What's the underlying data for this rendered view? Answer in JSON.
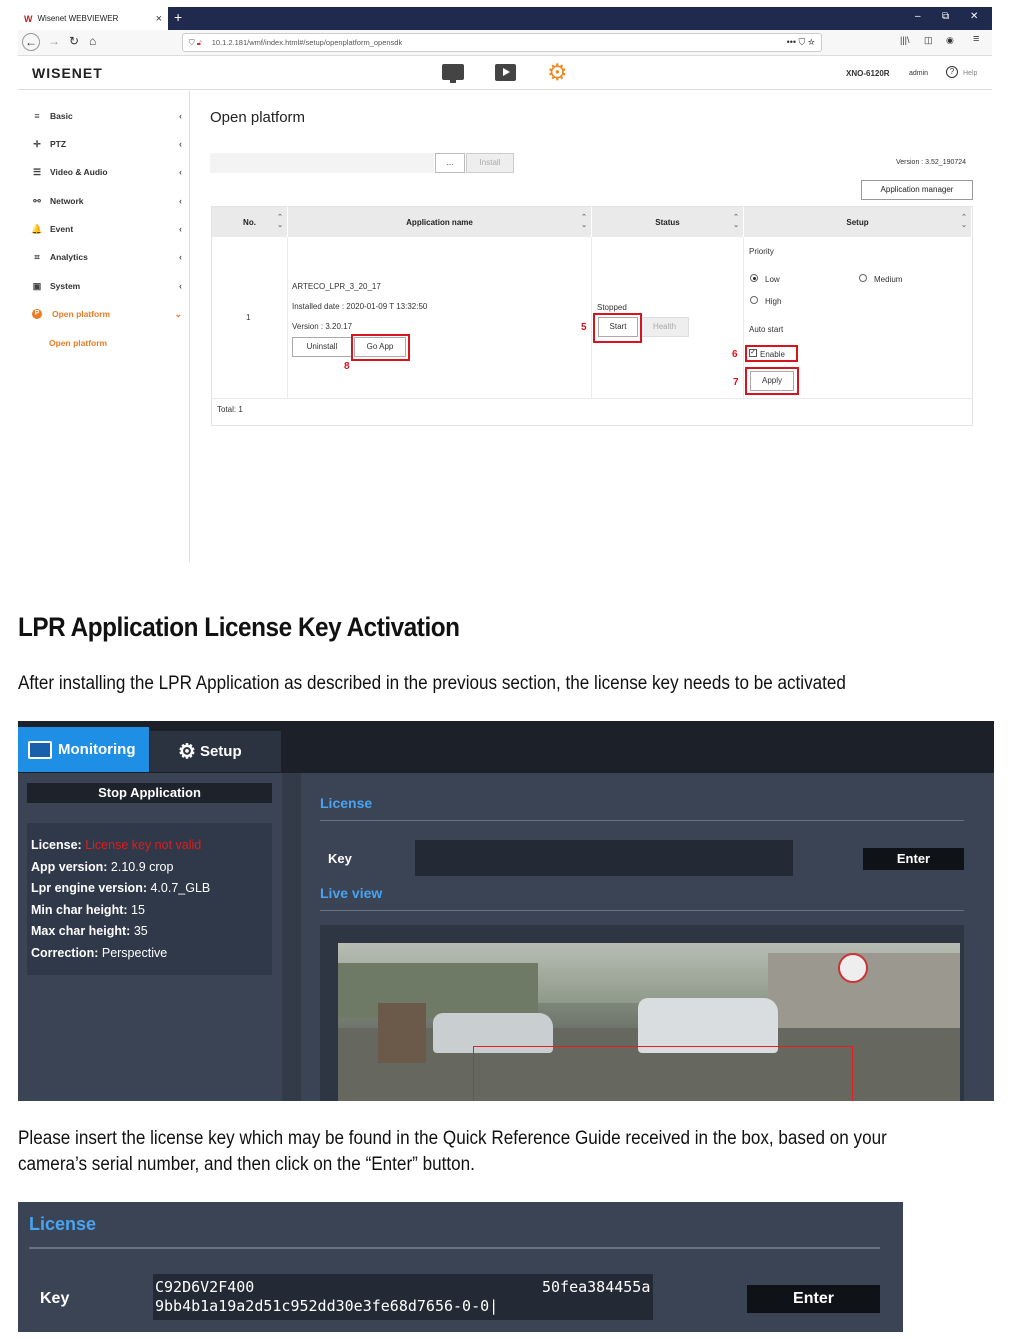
{
  "browser": {
    "tab_title": "Wisenet WEBVIEWER",
    "tab_logo": "W",
    "new_tab": "+",
    "url": "10.1.2.181/wmf/index.html#/setup/openplatform_opensdk",
    "url_dots": "•••",
    "win_min": "–",
    "win_restore": "⧉",
    "win_close": "✕"
  },
  "webviewer": {
    "logo": "WISENET",
    "model": "XNO-6120R",
    "user": "admin",
    "help": "Help",
    "help_icon": "?"
  },
  "sidebar": {
    "items": [
      {
        "label": "Basic",
        "icon": "≡"
      },
      {
        "label": "PTZ",
        "icon": "✛"
      },
      {
        "label": "Video & Audio",
        "icon": "☰"
      },
      {
        "label": "Network",
        "icon": "⚯"
      },
      {
        "label": "Event",
        "icon": "🔔"
      },
      {
        "label": "Analytics",
        "icon": "⌗"
      },
      {
        "label": "System",
        "icon": "▣"
      },
      {
        "label": "Open platform",
        "icon": "P"
      }
    ],
    "sub_item": "Open platform"
  },
  "content": {
    "title": "Open platform",
    "browse_button": "...",
    "install_button": "Install",
    "version": "Version : 3.52_190724",
    "app_manager_button": "Application manager",
    "table": {
      "headers": [
        "No.",
        "Application name",
        "Status",
        "Setup"
      ],
      "row": {
        "no": "1",
        "app_name": "ARTECO_LPR_3_20_17",
        "installed_date": "Installed date : 2020-01-09 T 13:32:50",
        "version": "Version : 3.20.17",
        "uninstall": "Uninstall",
        "go_app": "Go App",
        "status": "Stopped",
        "start": "Start",
        "health": "Health",
        "priority_label": "Priority",
        "priority_low": "Low",
        "priority_medium": "Medium",
        "priority_high": "High",
        "priority_selected": "Low",
        "auto_start_label": "Auto start",
        "enable_label": "Enable",
        "enable_checked": true,
        "apply": "Apply"
      },
      "total": "Total: 1"
    },
    "markers": [
      "5",
      "6",
      "7",
      "8"
    ]
  },
  "doc": {
    "heading": "LPR Application License Key Activation",
    "para1": "After installing the LPR Application as described in the previous section, the license key needs to be activated",
    "para2_line1": "Please insert the license key which may be found in the Quick Reference Guide received in the box, based on your",
    "para2_line2": "camera’s serial number, and then click on the “Enter” button."
  },
  "arteco": {
    "monitoring_tab": "Monitoring",
    "setup_tab": "Setup",
    "stop_button": "Stop Application",
    "info": {
      "license_label": "License:",
      "license_value": "License key not valid",
      "app_version_label": "App version:",
      "app_version_value": "2.10.9 crop",
      "lpr_engine_label": "Lpr engine version:",
      "lpr_engine_value": "4.0.7_GLB",
      "min_char_label": "Min char height:",
      "min_char_value": "15",
      "max_char_label": "Max char height:",
      "max_char_value": "35",
      "correction_label": "Correction:",
      "correction_value": "Perspective"
    },
    "license_section": "License",
    "key_label": "Key",
    "enter_button": "Enter",
    "live_view_section": "Live view"
  },
  "license_zoom": {
    "title": "License",
    "key_label": "Key",
    "key_line1_start": "C92D6V2F400",
    "key_line1_end": "50fea384455a",
    "key_line2": "9bb4b1a19a2d51c952dd30e3fe68d7656-0-0",
    "enter_button": "Enter"
  },
  "colors": {
    "accent_orange": "#e97c25",
    "annotation_red": "#d9121f",
    "arteco_blue": "#1f8fe6",
    "arteco_section_blue": "#4aa3f0",
    "arteco_bg": "#3a4454"
  }
}
